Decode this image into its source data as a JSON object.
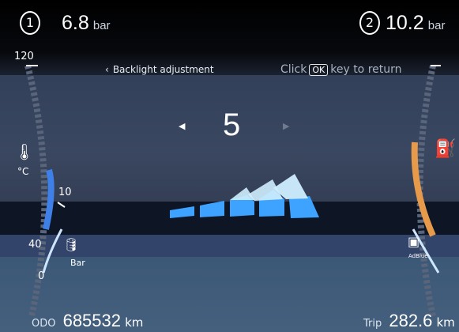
{
  "top": {
    "gauge1": {
      "index": "1",
      "value": "6.8",
      "unit": "bar"
    },
    "gauge2": {
      "index": "2",
      "value": "10.2",
      "unit": "bar"
    }
  },
  "menu": {
    "back_label": "Backlight adjustment",
    "hint_prefix": "Click",
    "hint_key": "OK",
    "hint_suffix": "key to return",
    "value": "5",
    "level_fraction": 0.5
  },
  "left_gauge": {
    "scale_top": "120",
    "scale_mid": "40",
    "scale_bottom": "0",
    "oil_scale": "10",
    "temp_unit": "°C",
    "oil_unit": "Bar"
  },
  "right_gauge": {
    "adblue_label": "AdBlue"
  },
  "footer": {
    "odo_label": "ODO",
    "odo_value": "685532",
    "odo_unit": "km",
    "trip_label": "Trip",
    "trip_value": "282.6",
    "trip_unit": "km"
  },
  "colors": {
    "temp_blue": "#3f7fe8",
    "fuel_orange": "#e79a4a",
    "bar_blue": "#3ea3ff",
    "bar_light": "#cfeeff"
  },
  "icons": [
    "chevron-left-icon",
    "arrow-left-icon",
    "arrow-right-icon",
    "coolant-temperature-icon",
    "oil-can-icon",
    "fuel-pump-icon",
    "adblue-icon"
  ]
}
